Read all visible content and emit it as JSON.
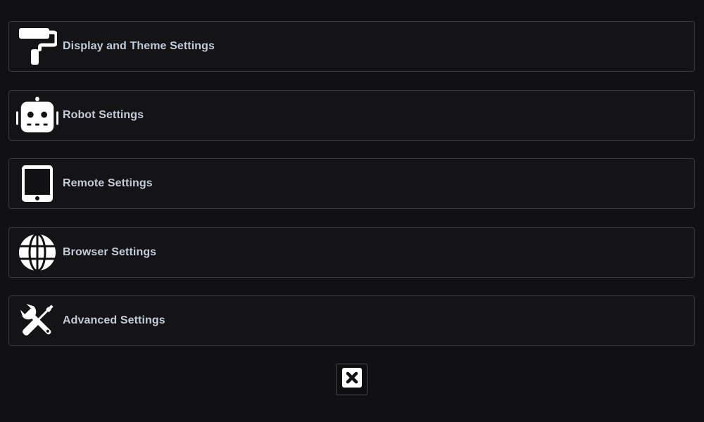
{
  "settings_menu": {
    "items": [
      {
        "label": "Display and Theme Settings",
        "icon": "paint-roller-icon"
      },
      {
        "label": "Robot Settings",
        "icon": "robot-icon"
      },
      {
        "label": "Remote Settings",
        "icon": "tablet-icon"
      },
      {
        "label": "Browser Settings",
        "icon": "globe-icon"
      },
      {
        "label": "Advanced Settings",
        "icon": "tools-icon"
      }
    ]
  },
  "close_button": {
    "icon": "close-icon"
  },
  "colors": {
    "background": "#111113",
    "item_border": "#3a3a3d",
    "label_text": "#c2cbd8",
    "icon": "#ffffff"
  }
}
